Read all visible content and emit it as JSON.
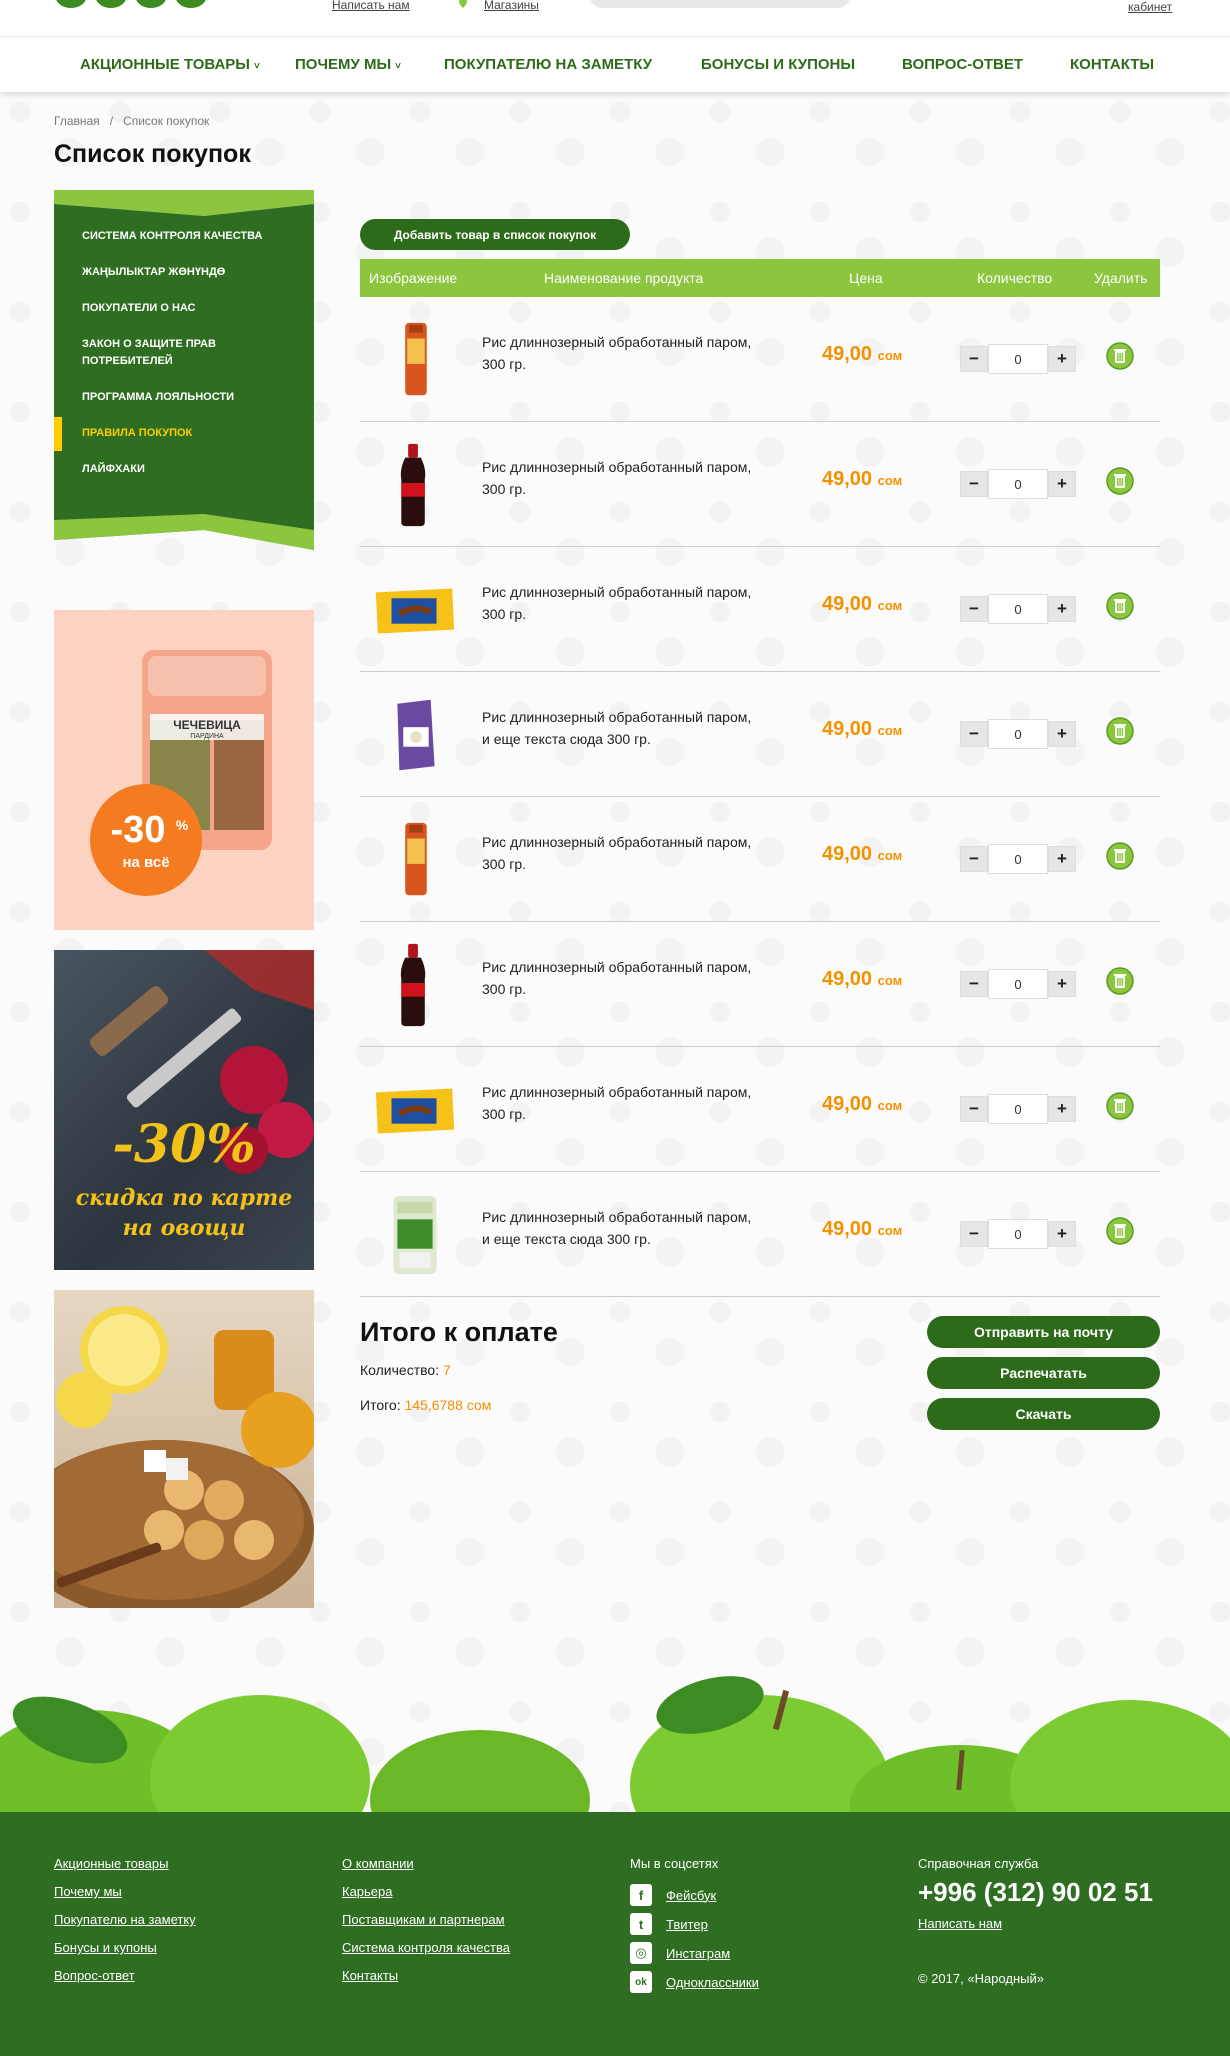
{
  "header": {
    "top_links": [
      "Написать нам",
      "Магазины"
    ],
    "account_label": "кабинет"
  },
  "nav": {
    "items": [
      {
        "label": "АКЦИОННЫЕ ТОВАРЫ",
        "dropdown": true
      },
      {
        "label": "ПОЧЕМУ МЫ",
        "dropdown": true
      },
      {
        "label": "ПОКУПАТЕЛЮ НА ЗАМЕТКУ",
        "dropdown": false
      },
      {
        "label": "БОНУСЫ И КУПОНЫ",
        "dropdown": false
      },
      {
        "label": "ВОПРОС-ОТВЕТ",
        "dropdown": false
      },
      {
        "label": "КОНТАКТЫ",
        "dropdown": false
      }
    ],
    "chevron": "˅"
  },
  "breadcrumb": {
    "home": "Главная",
    "separator": "/",
    "current": "Список покупок"
  },
  "page_title": "Список покупок",
  "sidebar": {
    "items": [
      {
        "label": "СИСТЕМА КОНТРОЛЯ КАЧЕСТВА"
      },
      {
        "label": "ЖАҢЫЛЫКТАР ЖӨНҮНДӨ"
      },
      {
        "label": "ПОКУПАТЕЛИ О НАС"
      },
      {
        "label": "ЗАКОН О ЗАЩИТЕ ПРАВ ПОТРЕБИТЕЛЕЙ"
      },
      {
        "label": "ПРОГРАММА ЛОЯЛЬНОСТИ"
      },
      {
        "label": "ПРАВИЛА ПОКУПОК",
        "active": true
      },
      {
        "label": "ЛАЙФХАКИ"
      }
    ]
  },
  "banners": {
    "banner1": {
      "pack_title": "ЧЕЧЕВИЦА",
      "pack_subtitle": "ПАРДИНА",
      "discount": "-30",
      "percent": "%",
      "note": "на всё"
    },
    "banner2": {
      "discount": "-30%",
      "line1": "скидка по карте",
      "line2": "на овощи"
    }
  },
  "add_button": "Добавить товар в список покупок",
  "table": {
    "headers": [
      "Изображение",
      "Наименование продукта",
      "Цена",
      "Количество",
      "Удалить"
    ],
    "rows": [
      {
        "name_line1": "Рис длиннозерный обработанный паром,",
        "name_line2": "300 гр.",
        "price": "49,00",
        "currency": "сом",
        "qty": "0",
        "image": "pasta-pack-icon"
      },
      {
        "name_line1": "Рис длиннозерный обработанный паром,",
        "name_line2": "300 гр.",
        "price": "49,00",
        "currency": "сом",
        "qty": "0",
        "image": "cola-bottle-icon"
      },
      {
        "name_line1": "Рис длиннозерный обработанный паром,",
        "name_line2": "300 гр.",
        "price": "49,00",
        "currency": "сом",
        "qty": "0",
        "image": "candy-pack-icon"
      },
      {
        "name_line1": "Рис длиннозерный обработанный паром,",
        "name_line2": "и еще текста сюда 300 гр.",
        "price": "49,00",
        "currency": "сом",
        "qty": "0",
        "image": "rice-box-icon"
      },
      {
        "name_line1": "Рис длиннозерный обработанный паром,",
        "name_line2": "300 гр.",
        "price": "49,00",
        "currency": "сом",
        "qty": "0",
        "image": "pasta-pack-icon"
      },
      {
        "name_line1": "Рис длиннозерный обработанный паром,",
        "name_line2": "300 гр.",
        "price": "49,00",
        "currency": "сом",
        "qty": "0",
        "image": "cola-bottle-icon"
      },
      {
        "name_line1": "Рис длиннозерный обработанный паром,",
        "name_line2": "300 гр.",
        "price": "49,00",
        "currency": "сом",
        "qty": "0",
        "image": "candy-pack-icon"
      },
      {
        "name_line1": "Рис длиннозерный обработанный паром,",
        "name_line2": "и еще текста сюда 300 гр.",
        "price": "49,00",
        "currency": "сом",
        "qty": "0",
        "image": "grain-pack-icon"
      }
    ],
    "minus": "−",
    "plus": "+"
  },
  "summary": {
    "title": "Итого к оплате",
    "qty_label": "Количество:",
    "qty_value": "7",
    "total_label": "Итого:",
    "total_value": "145,6788 сом",
    "buttons": [
      "Отправить на почту",
      "Распечатать",
      "Скачать"
    ]
  },
  "footer": {
    "col1": [
      "Акционные товары",
      "Почему мы",
      "Покупателю на заметку",
      "Бонусы и купоны",
      "Вопрос-ответ"
    ],
    "col2": [
      "О компании",
      "Карьера",
      "Поставщикам и партнерам",
      "Система контроля качества",
      "Контакты"
    ],
    "social_title": "Мы в соцсетях",
    "social": [
      {
        "label": "Фейсбук",
        "icon": "facebook-icon",
        "glyph": "f"
      },
      {
        "label": "Твитер",
        "icon": "twitter-icon",
        "glyph": "t"
      },
      {
        "label": "Инстаграм",
        "icon": "instagram-icon",
        "glyph": "◎"
      },
      {
        "label": "Одноклассники",
        "icon": "odnoklassniki-icon",
        "glyph": "ok"
      }
    ],
    "help_title": "Справочная служба",
    "phone": "+996 (312) 90 02 51",
    "write_us": "Написать нам",
    "copyright": "© 2017, «Народный»"
  },
  "colors": {
    "brand_green": "#2d6b1a",
    "lime": "#8cc63f",
    "price_orange": "#f39200",
    "active_yellow": "#ffcc00",
    "footer_green": "#2f6e22"
  }
}
